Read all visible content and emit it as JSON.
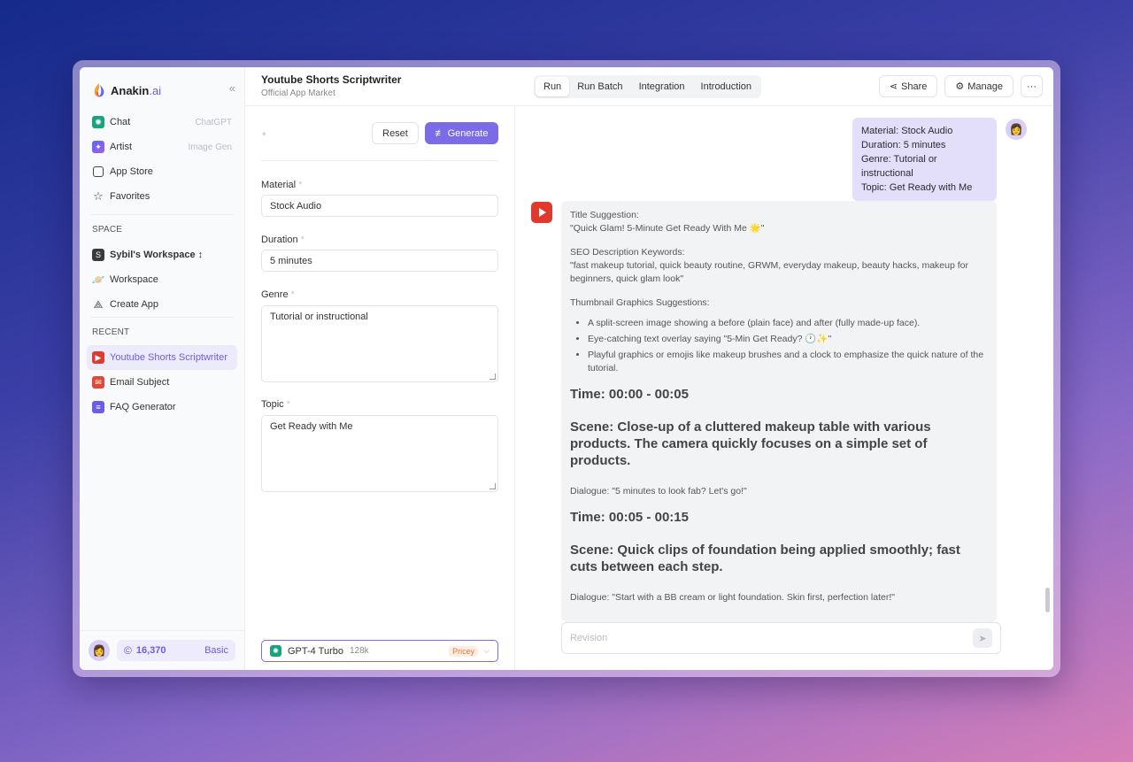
{
  "brand": {
    "name_main": "Anakin",
    "name_suffix": ".ai"
  },
  "sidebar": {
    "top_items": [
      {
        "label": "Chat",
        "hint": "ChatGPT",
        "icon": "openai-icon",
        "color": "#19a37f"
      },
      {
        "label": "Artist",
        "hint": "Image Gen",
        "icon": "artist-icon",
        "color": "#5b6cf0"
      },
      {
        "label": "App Store",
        "hint": "",
        "icon": "app-store-icon"
      },
      {
        "label": "Favorites",
        "hint": "",
        "icon": "star-icon"
      }
    ],
    "space_label": "SPACE",
    "space_items": [
      {
        "label": "Sybil's Workspace ↕",
        "icon": "workspace-s-icon",
        "badge": "S"
      },
      {
        "label": "Workspace",
        "icon": "planet-icon"
      },
      {
        "label": "Create App",
        "icon": "create-app-icon"
      }
    ],
    "recent_label": "RECENT",
    "recent_items": [
      {
        "label": "Youtube Shorts Scriptwriter",
        "icon": "youtube-icon",
        "color": "#e03a2f"
      },
      {
        "label": "Email Subject",
        "icon": "email-icon",
        "color": "#e0493a"
      },
      {
        "label": "FAQ Generator",
        "icon": "faq-icon",
        "color": "#6d5ce8"
      }
    ],
    "credits": "16,370",
    "plan": "Basic"
  },
  "header": {
    "title": "Youtube Shorts Scriptwriter",
    "subtitle": "Official App Market",
    "tabs": [
      "Run",
      "Run Batch",
      "Integration",
      "Introduction"
    ],
    "share_label": "Share",
    "manage_label": "Manage",
    "more_label": "···"
  },
  "form": {
    "reset_label": "Reset",
    "generate_label": "Generate",
    "fields": [
      {
        "label": "Material",
        "value": "Stock Audio"
      },
      {
        "label": "Duration",
        "value": "5 minutes"
      },
      {
        "label": "Genre",
        "value": "Tutorial or instructional"
      },
      {
        "label": "Topic",
        "value": "Get Ready with Me"
      }
    ],
    "model": {
      "name": "GPT-4 Turbo",
      "context": "128k",
      "tag": "Pricey"
    }
  },
  "chat": {
    "user_message": [
      "Material: Stock Audio",
      "Duration: 5 minutes",
      "Genre: Tutorial or instructional",
      "Topic: Get Ready with Me"
    ],
    "bot": {
      "title_label": "Title Suggestion:",
      "title_value": "\"Quick Glam! 5-Minute Get Ready With Me 🌟\"",
      "seo_label": "SEO Description Keywords:",
      "seo_value": "\"fast makeup tutorial, quick beauty routine, GRWM, everyday makeup, beauty hacks, makeup for beginners, quick glam look\"",
      "thumb_label": "Thumbnail Graphics Suggestions:",
      "thumb_items": [
        "A split-screen image showing a before (plain face) and after (fully made-up face).",
        "Eye-catching text overlay saying \"5-Min Get Ready? 🕐✨\"",
        "Playful graphics or emojis like makeup brushes and a clock to emphasize the quick nature of the tutorial."
      ],
      "time1": "Time: 00:00 - 00:05",
      "scene1": "Scene: Close-up of a cluttered makeup table with various products. The camera quickly focuses on a simple set of products.",
      "dialogue1": "Dialogue: \"5 minutes to look fab? Let's go!\"",
      "time2": "Time: 00:05 - 00:15",
      "scene2": "Scene: Quick clips of foundation being applied smoothly; fast cuts between each step.",
      "dialogue2": "Dialogue: \"Start with a BB cream or light foundation. Skin first, perfection later!\""
    },
    "revision_placeholder": "Revision"
  },
  "colors": {
    "accent": "#7b6be6",
    "youtube": "#e03a2f"
  }
}
